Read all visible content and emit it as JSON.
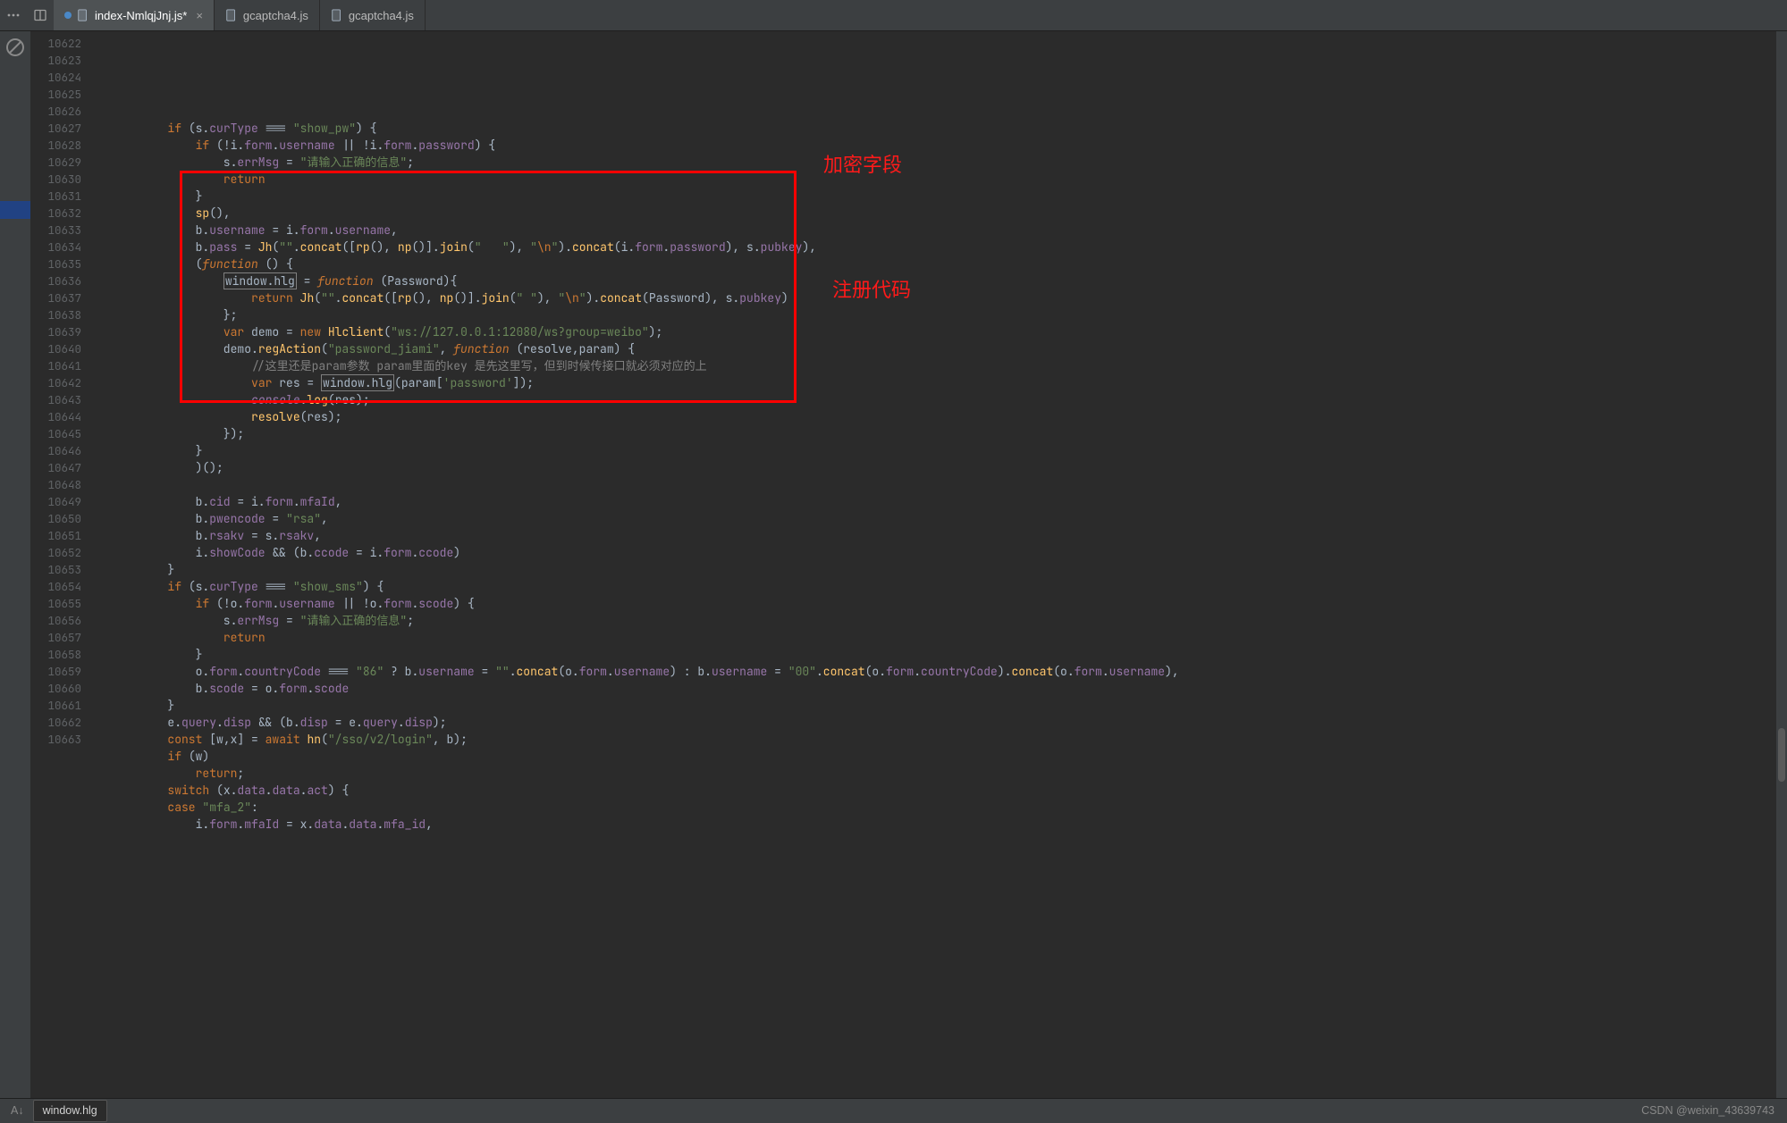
{
  "tabs": [
    {
      "label": "index-NmlqjJnj.js*",
      "active": true,
      "modified": true
    },
    {
      "label": "gcaptcha4.js",
      "active": false,
      "modified": false
    },
    {
      "label": "gcaptcha4.js",
      "active": false,
      "modified": false
    }
  ],
  "gutter_start": 10622,
  "gutter_end": 10663,
  "annotations": {
    "label_encrypt": "加密字段",
    "label_register": "注册代码"
  },
  "statusbar": {
    "breadcrumb": "window.hlg",
    "watermark": "CSDN @weixin_43639743"
  },
  "code_tokens": [
    [
      [
        "id",
        "        "
      ],
      [
        "kw",
        "if"
      ],
      [
        "id",
        " (s."
      ],
      [
        "prop",
        "curType"
      ],
      [
        "id",
        " === "
      ],
      [
        "str",
        "\"show_pw\""
      ],
      [
        "id",
        ") {"
      ]
    ],
    [
      [
        "id",
        "            "
      ],
      [
        "kw",
        "if"
      ],
      [
        "id",
        " (!i."
      ],
      [
        "prop",
        "form"
      ],
      [
        "id",
        "."
      ],
      [
        "prop",
        "username"
      ],
      [
        "id",
        " || !i."
      ],
      [
        "prop",
        "form"
      ],
      [
        "id",
        "."
      ],
      [
        "prop",
        "password"
      ],
      [
        "id",
        ") {"
      ]
    ],
    [
      [
        "id",
        "                s."
      ],
      [
        "prop",
        "errMsg"
      ],
      [
        "id",
        " = "
      ],
      [
        "str",
        "\"请输入正确的信息\""
      ],
      [
        "id",
        ";"
      ]
    ],
    [
      [
        "id",
        "                "
      ],
      [
        "kw",
        "return"
      ]
    ],
    [
      [
        "id",
        "            }"
      ]
    ],
    [
      [
        "id",
        "            "
      ],
      [
        "fn",
        "sp"
      ],
      [
        "id",
        "(),"
      ]
    ],
    [
      [
        "id",
        "            b."
      ],
      [
        "prop",
        "username"
      ],
      [
        "id",
        " = i."
      ],
      [
        "prop",
        "form"
      ],
      [
        "id",
        "."
      ],
      [
        "prop",
        "username"
      ],
      [
        "id",
        ","
      ]
    ],
    [
      [
        "id",
        "            b."
      ],
      [
        "prop",
        "pass"
      ],
      [
        "id",
        " = "
      ],
      [
        "fn",
        "Jh"
      ],
      [
        "id",
        "("
      ],
      [
        "str",
        "\"\""
      ],
      [
        "id",
        "."
      ],
      [
        "fn",
        "concat"
      ],
      [
        "id",
        "(["
      ],
      [
        "fn",
        "rp"
      ],
      [
        "id",
        "(), "
      ],
      [
        "fn",
        "np"
      ],
      [
        "id",
        "()]."
      ],
      [
        "fn",
        "join"
      ],
      [
        "id",
        "("
      ],
      [
        "str",
        "\"   \""
      ],
      [
        "id",
        "), "
      ],
      [
        "str",
        "\""
      ],
      [
        "esc",
        "\\n"
      ],
      [
        "str",
        "\""
      ],
      [
        "id",
        ")."
      ],
      [
        "fn",
        "concat"
      ],
      [
        "id",
        "(i."
      ],
      [
        "prop",
        "form"
      ],
      [
        "id",
        "."
      ],
      [
        "prop",
        "password"
      ],
      [
        "id",
        "), s."
      ],
      [
        "prop",
        "pubkey"
      ],
      [
        "id",
        "),"
      ]
    ],
    [
      [
        "id",
        "            ("
      ],
      [
        "fkw",
        "function"
      ],
      [
        "id",
        " () {"
      ]
    ],
    [
      [
        "id",
        "                "
      ],
      [
        "boxed",
        "window.hlg"
      ],
      [
        "id",
        " = "
      ],
      [
        "fkw",
        "function"
      ],
      [
        "id",
        " ("
      ],
      [
        "type",
        "Password"
      ],
      [
        "id",
        "){"
      ]
    ],
    [
      [
        "id",
        "                    "
      ],
      [
        "kw",
        "return"
      ],
      [
        "id",
        " "
      ],
      [
        "fn",
        "Jh"
      ],
      [
        "id",
        "("
      ],
      [
        "str",
        "\"\""
      ],
      [
        "id",
        "."
      ],
      [
        "fn",
        "concat"
      ],
      [
        "id",
        "(["
      ],
      [
        "fn",
        "rp"
      ],
      [
        "id",
        "(), "
      ],
      [
        "fn",
        "np"
      ],
      [
        "id",
        "()]."
      ],
      [
        "fn",
        "join"
      ],
      [
        "id",
        "("
      ],
      [
        "str",
        "\" \""
      ],
      [
        "id",
        "), "
      ],
      [
        "str",
        "\""
      ],
      [
        "esc",
        "\\n"
      ],
      [
        "str",
        "\""
      ],
      [
        "id",
        ")."
      ],
      [
        "fn",
        "concat"
      ],
      [
        "id",
        "(Password), s."
      ],
      [
        "prop",
        "pubkey"
      ],
      [
        "id",
        ")"
      ]
    ],
    [
      [
        "id",
        "                };"
      ]
    ],
    [
      [
        "id",
        "                "
      ],
      [
        "kw",
        "var"
      ],
      [
        "id",
        " demo = "
      ],
      [
        "new",
        "new"
      ],
      [
        "id",
        " "
      ],
      [
        "fn",
        "Hlclient"
      ],
      [
        "id",
        "("
      ],
      [
        "str",
        "\"ws://127.0.0.1:12080/ws?group=weibo\""
      ],
      [
        "id",
        ");"
      ]
    ],
    [
      [
        "id",
        "                demo."
      ],
      [
        "fn",
        "regAction"
      ],
      [
        "id",
        "("
      ],
      [
        "str",
        "\"password_jiami\""
      ],
      [
        "id",
        ", "
      ],
      [
        "fkw",
        "function"
      ],
      [
        "id",
        " (resolve,param) {"
      ]
    ],
    [
      [
        "id",
        "                    "
      ],
      [
        "cmt",
        "//这里还是param参数 param里面的key 是先这里写，但到时候传接口就必须对应的上"
      ]
    ],
    [
      [
        "id",
        "                    "
      ],
      [
        "kw",
        "var"
      ],
      [
        "id",
        " res = "
      ],
      [
        "boxed",
        "window.hlg"
      ],
      [
        "id",
        "(param["
      ],
      [
        "str",
        "'password'"
      ],
      [
        "id",
        "]);"
      ]
    ],
    [
      [
        "id",
        "                    "
      ],
      [
        "glob",
        "console"
      ],
      [
        "id",
        "."
      ],
      [
        "fn",
        "log"
      ],
      [
        "id",
        "(res);"
      ]
    ],
    [
      [
        "id",
        "                    "
      ],
      [
        "fn",
        "resolve"
      ],
      [
        "id",
        "(res);"
      ]
    ],
    [
      [
        "id",
        "                });"
      ]
    ],
    [
      [
        "id",
        "            }"
      ]
    ],
    [
      [
        "id",
        "            )();"
      ]
    ],
    [
      [
        "id",
        ""
      ]
    ],
    [
      [
        "id",
        "            b."
      ],
      [
        "prop",
        "cid"
      ],
      [
        "id",
        " = i."
      ],
      [
        "prop",
        "form"
      ],
      [
        "id",
        "."
      ],
      [
        "prop",
        "mfaId"
      ],
      [
        "id",
        ","
      ]
    ],
    [
      [
        "id",
        "            b."
      ],
      [
        "prop",
        "pwencode"
      ],
      [
        "id",
        " = "
      ],
      [
        "str",
        "\"rsa\""
      ],
      [
        "id",
        ","
      ]
    ],
    [
      [
        "id",
        "            b."
      ],
      [
        "prop",
        "rsakv"
      ],
      [
        "id",
        " = s."
      ],
      [
        "prop",
        "rsakv"
      ],
      [
        "id",
        ","
      ]
    ],
    [
      [
        "id",
        "            i."
      ],
      [
        "prop",
        "showCode"
      ],
      [
        "id",
        " && (b."
      ],
      [
        "prop",
        "ccode"
      ],
      [
        "id",
        " = i."
      ],
      [
        "prop",
        "form"
      ],
      [
        "id",
        "."
      ],
      [
        "prop",
        "ccode"
      ],
      [
        "id",
        ")"
      ]
    ],
    [
      [
        "id",
        "        }"
      ]
    ],
    [
      [
        "id",
        "        "
      ],
      [
        "kw",
        "if"
      ],
      [
        "id",
        " (s."
      ],
      [
        "prop",
        "curType"
      ],
      [
        "id",
        " === "
      ],
      [
        "str",
        "\"show_sms\""
      ],
      [
        "id",
        ") {"
      ]
    ],
    [
      [
        "id",
        "            "
      ],
      [
        "kw",
        "if"
      ],
      [
        "id",
        " (!o."
      ],
      [
        "prop",
        "form"
      ],
      [
        "id",
        "."
      ],
      [
        "prop",
        "username"
      ],
      [
        "id",
        " || !o."
      ],
      [
        "prop",
        "form"
      ],
      [
        "id",
        "."
      ],
      [
        "prop",
        "scode"
      ],
      [
        "id",
        ") {"
      ]
    ],
    [
      [
        "id",
        "                s."
      ],
      [
        "prop",
        "errMsg"
      ],
      [
        "id",
        " = "
      ],
      [
        "str",
        "\"请输入正确的信息\""
      ],
      [
        "id",
        ";"
      ]
    ],
    [
      [
        "id",
        "                "
      ],
      [
        "kw",
        "return"
      ]
    ],
    [
      [
        "id",
        "            }"
      ]
    ],
    [
      [
        "id",
        "            o."
      ],
      [
        "prop",
        "form"
      ],
      [
        "id",
        "."
      ],
      [
        "prop",
        "countryCode"
      ],
      [
        "id",
        " === "
      ],
      [
        "str",
        "\"86\""
      ],
      [
        "id",
        " ? b."
      ],
      [
        "prop",
        "username"
      ],
      [
        "id",
        " = "
      ],
      [
        "str",
        "\"\""
      ],
      [
        "id",
        "."
      ],
      [
        "fn",
        "concat"
      ],
      [
        "id",
        "(o."
      ],
      [
        "prop",
        "form"
      ],
      [
        "id",
        "."
      ],
      [
        "prop",
        "username"
      ],
      [
        "id",
        ") : b."
      ],
      [
        "prop",
        "username"
      ],
      [
        "id",
        " = "
      ],
      [
        "str",
        "\"00\""
      ],
      [
        "id",
        "."
      ],
      [
        "fn",
        "concat"
      ],
      [
        "id",
        "(o."
      ],
      [
        "prop",
        "form"
      ],
      [
        "id",
        "."
      ],
      [
        "prop",
        "countryCode"
      ],
      [
        "id",
        ")."
      ],
      [
        "fn",
        "concat"
      ],
      [
        "id",
        "(o."
      ],
      [
        "prop",
        "form"
      ],
      [
        "id",
        "."
      ],
      [
        "prop",
        "username"
      ],
      [
        "id",
        "),"
      ]
    ],
    [
      [
        "id",
        "            b."
      ],
      [
        "prop",
        "scode"
      ],
      [
        "id",
        " = o."
      ],
      [
        "prop",
        "form"
      ],
      [
        "id",
        "."
      ],
      [
        "prop",
        "scode"
      ]
    ],
    [
      [
        "id",
        "        }"
      ]
    ],
    [
      [
        "id",
        "        e."
      ],
      [
        "prop",
        "query"
      ],
      [
        "id",
        "."
      ],
      [
        "prop",
        "disp"
      ],
      [
        "id",
        " && (b."
      ],
      [
        "prop",
        "disp"
      ],
      [
        "id",
        " = e."
      ],
      [
        "prop",
        "query"
      ],
      [
        "id",
        "."
      ],
      [
        "prop",
        "disp"
      ],
      [
        "id",
        ");"
      ]
    ],
    [
      [
        "id",
        "        "
      ],
      [
        "kw",
        "const"
      ],
      [
        "id",
        " [w,x] = "
      ],
      [
        "kw",
        "await"
      ],
      [
        "id",
        " "
      ],
      [
        "fn",
        "hn"
      ],
      [
        "id",
        "("
      ],
      [
        "str",
        "\"/sso/v2/login\""
      ],
      [
        "id",
        ", b);"
      ]
    ],
    [
      [
        "id",
        "        "
      ],
      [
        "kw",
        "if"
      ],
      [
        "id",
        " (w)"
      ]
    ],
    [
      [
        "id",
        "            "
      ],
      [
        "kw",
        "return"
      ],
      [
        "id",
        ";"
      ]
    ],
    [
      [
        "id",
        "        "
      ],
      [
        "kw",
        "switch"
      ],
      [
        "id",
        " (x."
      ],
      [
        "prop",
        "data"
      ],
      [
        "id",
        "."
      ],
      [
        "prop",
        "data"
      ],
      [
        "id",
        "."
      ],
      [
        "prop",
        "act"
      ],
      [
        "id",
        ") {"
      ]
    ],
    [
      [
        "id",
        "        "
      ],
      [
        "kw",
        "case"
      ],
      [
        "id",
        " "
      ],
      [
        "str",
        "\"mfa_2\""
      ],
      [
        "id",
        ":"
      ]
    ],
    [
      [
        "id",
        "            i."
      ],
      [
        "prop",
        "form"
      ],
      [
        "id",
        "."
      ],
      [
        "prop",
        "mfaId"
      ],
      [
        "id",
        " = x."
      ],
      [
        "prop",
        "data"
      ],
      [
        "id",
        "."
      ],
      [
        "prop",
        "data"
      ],
      [
        "id",
        "."
      ],
      [
        "prop",
        "mfa_id"
      ],
      [
        "id",
        ","
      ]
    ]
  ]
}
